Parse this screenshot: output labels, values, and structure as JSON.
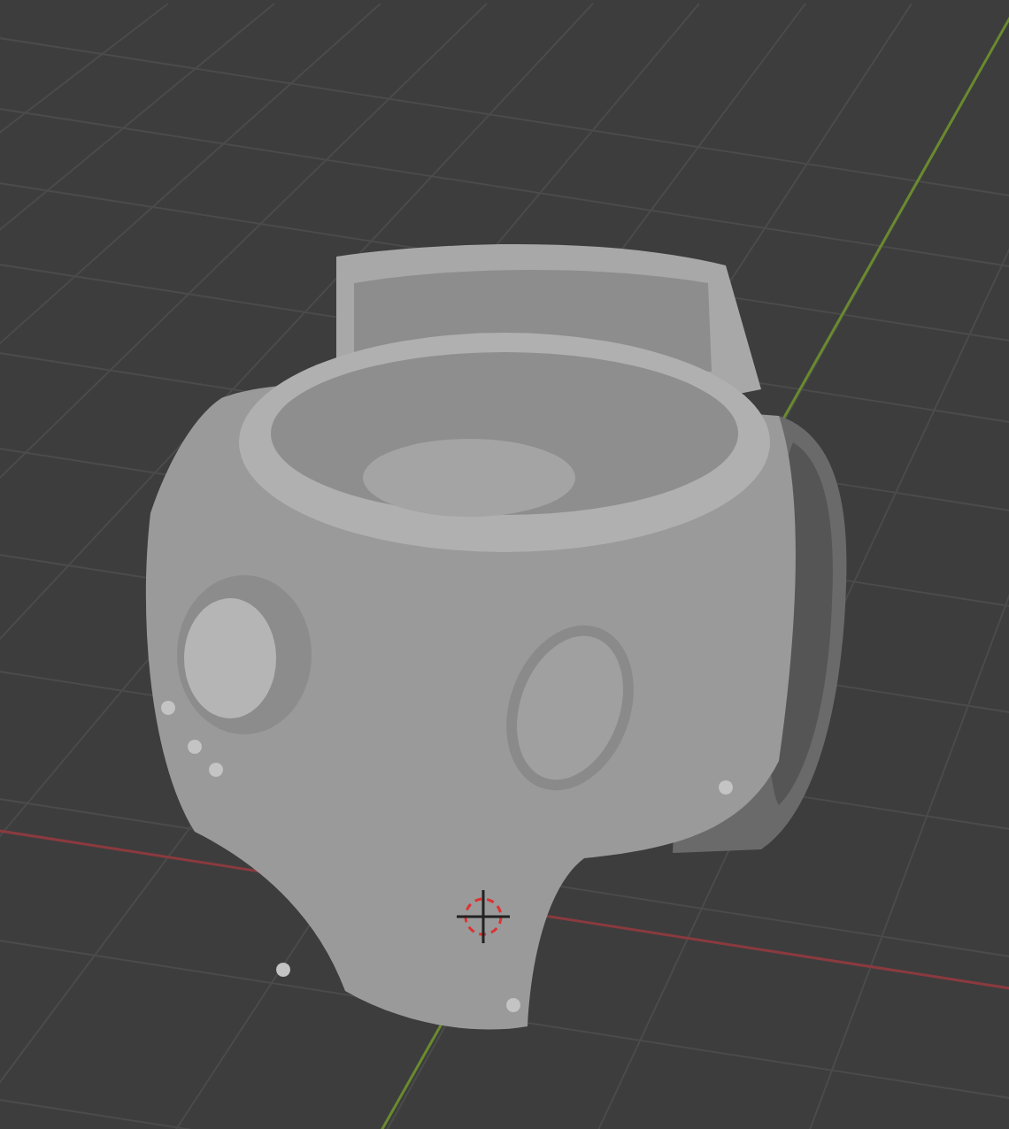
{
  "viewport": {
    "axes": [
      {
        "kind": "x",
        "color": "#8a3a3f"
      },
      {
        "kind": "y",
        "color": "#6a8a2e"
      }
    ]
  }
}
